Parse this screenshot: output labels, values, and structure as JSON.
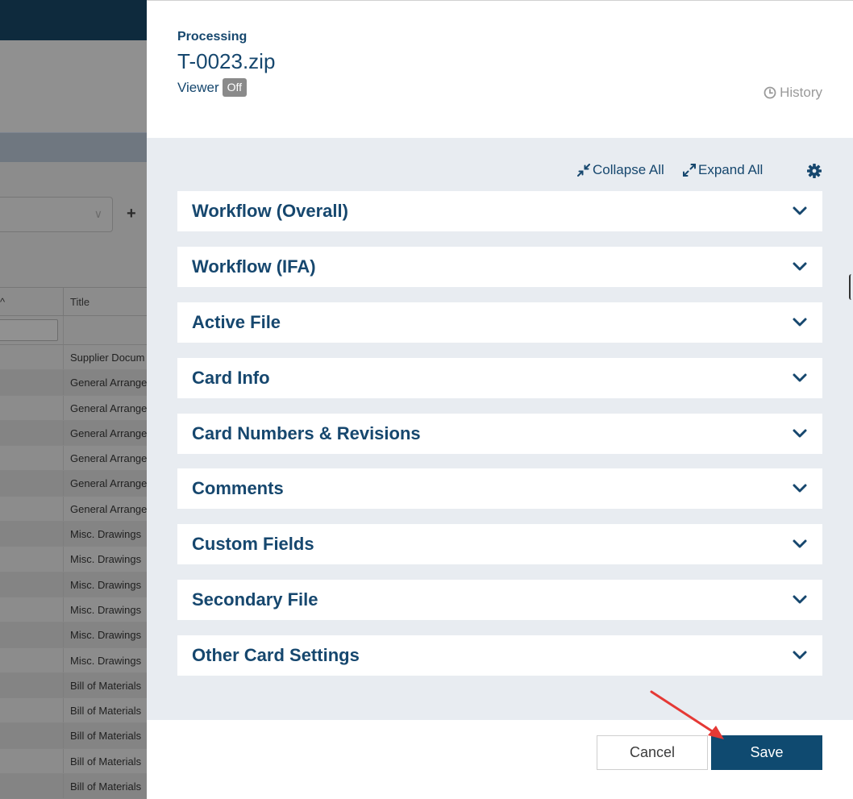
{
  "background_app": {
    "table": {
      "header_title": "Title",
      "rows": [
        "Supplier Docum",
        "General Arrange",
        "General Arrange",
        "General Arrange",
        "General Arrange",
        "General Arrange",
        "General Arrange",
        "Misc. Drawings",
        "Misc. Drawings",
        "Misc. Drawings",
        "Misc. Drawings",
        "Misc. Drawings",
        "Misc. Drawings",
        "Bill of Materials",
        "Bill of Materials",
        "Bill of Materials",
        "Bill of Materials",
        "Bill of Materials"
      ]
    },
    "add_symbol": "+",
    "sort_symbol": "^"
  },
  "panel": {
    "status": "Processing",
    "file_name": "T-0023.zip",
    "viewer_label": "Viewer",
    "viewer_state": "Off",
    "history_label": "History",
    "toolbar": {
      "collapse_all": "Collapse All",
      "expand_all": "Expand All",
      "settings_icon": "gear-icon"
    },
    "sections": [
      "Workflow (Overall)",
      "Workflow (IFA)",
      "Active File",
      "Card Info",
      "Card Numbers & Revisions",
      "Comments",
      "Custom Fields",
      "Secondary File",
      "Other Card Settings"
    ],
    "footer": {
      "cancel_label": "Cancel",
      "save_label": "Save"
    }
  },
  "colors": {
    "brand_navy": "#16476e",
    "save_button": "#0f4a70",
    "body_bg": "#e8ecf1",
    "annotation_arrow": "#e53935"
  }
}
